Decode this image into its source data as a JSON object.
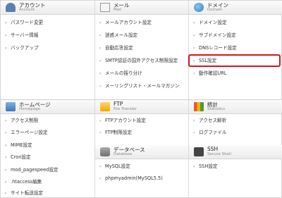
{
  "sections": {
    "account": {
      "title": "アカウント",
      "subtitle": "Account",
      "items": [
        "パスワード変更",
        "サーバー情報",
        "バックアップ"
      ]
    },
    "mail": {
      "title": "メール",
      "subtitle": "Mail",
      "items": [
        "メールアカウント設定",
        "迷惑メール設定",
        "自動応答設定",
        "SMTP認証の国外アクセス制限設定",
        "メールの振り分け",
        "メーリングリスト・メールマガジン"
      ]
    },
    "domain": {
      "title": "ドメイン",
      "subtitle": "Domain",
      "items": [
        "ドメイン設定",
        "サブドメイン設定",
        "DNSレコード設定",
        "SSL設定",
        "動作確認URL"
      ]
    },
    "homepage": {
      "title": "ホームページ",
      "subtitle": "Homepage",
      "items": [
        "アクセス制限",
        "エラーページ設定",
        "MIME設定",
        "Cron設定",
        "mod_pagespeed設定",
        ".htaccess編集",
        "サイト転送設定"
      ]
    },
    "ftp": {
      "title": "FTP",
      "subtitle": "File Transfer",
      "items": [
        "FTPアカウント設定",
        "FTP制限設定"
      ]
    },
    "stats": {
      "title": "統計",
      "subtitle": "Statistics",
      "items": [
        "アクセス解析",
        "ログファイル"
      ]
    },
    "database": {
      "title": "データベース",
      "subtitle": "Database",
      "items": [
        "MySQL設定",
        "phpmyadmin(MySQL5.5)"
      ]
    },
    "ssh": {
      "title": "SSH",
      "subtitle": "Secure Shell",
      "items": [
        "SSH設定"
      ]
    }
  },
  "highlighted_item": "SSL設定",
  "colors": {
    "highlight": "#d8141b",
    "arrow": "#4a6fa0"
  },
  "icons": {
    "account": "person-icon",
    "mail": "mail-icon",
    "domain": "globe-icon",
    "homepage": "home-icon",
    "ftp": "folder-icon",
    "stats": "chart-icon",
    "database": "database-icon",
    "ssh": "terminal-icon"
  }
}
